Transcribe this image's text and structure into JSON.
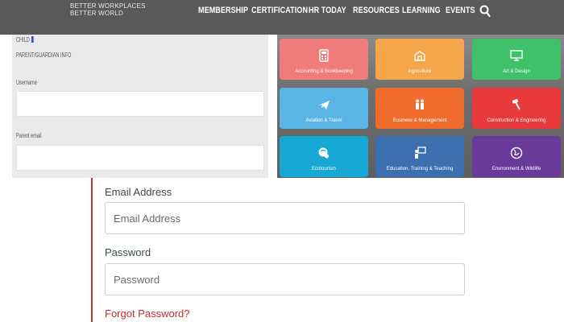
{
  "header": {
    "logo_line1": "BETTER WORKPLACES",
    "logo_line2": "BETTER WORLD",
    "nav": [
      "MEMBERSHIP",
      "CERTIFICATION",
      "HR TODAY",
      "RESOURCES",
      "LEARNING",
      "EVENTS"
    ],
    "search_icon": "search-icon"
  },
  "left_panel": {
    "line1": "CHILD",
    "line2": "PARENT/GUARDIAN INFO",
    "username_label": "Username",
    "email_label": "Parent email"
  },
  "tiles": [
    {
      "label": "Accounting & Bookkeeping",
      "color": "#ef7b7b",
      "icon": "calculator-icon"
    },
    {
      "label": "Agriculture",
      "color": "#f5a54a",
      "icon": "farm-icon"
    },
    {
      "label": "Art & Design",
      "color": "#3fc16a",
      "icon": "monitor-icon"
    },
    {
      "label": "Aviation & Travel",
      "color": "#5ab5e5",
      "icon": "airplane-icon"
    },
    {
      "label": "Business & Management",
      "color": "#ef6b2c",
      "icon": "business-people-icon"
    },
    {
      "label": "Construction & Engineering",
      "color": "#e83a3a",
      "icon": "hammer-icon"
    },
    {
      "label": "Ecotourism",
      "color": "#17a8d6",
      "icon": "ecotourism-icon"
    },
    {
      "label": "Education, Training & Teaching",
      "color": "#3b6fb0",
      "icon": "teacher-icon"
    },
    {
      "label": "Environment & Wildlife",
      "color": "#6a3a9a",
      "icon": "globe-icon"
    }
  ],
  "login": {
    "email_label": "Email Address",
    "email_placeholder": "Email Address",
    "password_label": "Password",
    "password_placeholder": "Password",
    "forgot": "Forgot Password?"
  },
  "colors": {
    "accent": "#c0302a",
    "nav_bg": "#595959"
  }
}
